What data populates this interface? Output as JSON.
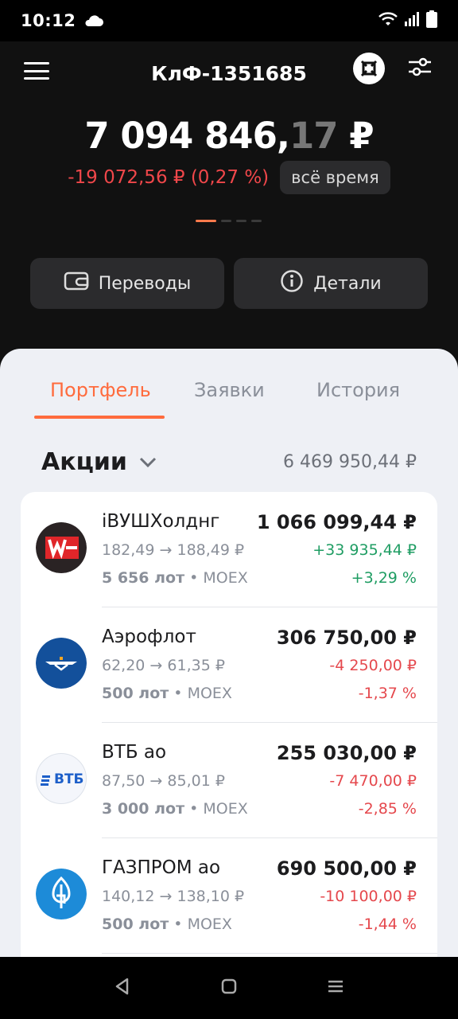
{
  "status_bar": {
    "time": "10:12",
    "icons": [
      "cloud-icon",
      "wifi-icon",
      "signal-icon",
      "battery-icon"
    ]
  },
  "header": {
    "account": "КлФ-1351685",
    "balance": {
      "int": "7 094 846,",
      "frac": "17",
      "currency": " ₽"
    },
    "change": "-19 072,56 ₽ (0,27 %)",
    "period": "всё время",
    "pager": {
      "count": 4,
      "active": 0
    },
    "buttons": {
      "transfers": "Переводы",
      "details": "Детали"
    }
  },
  "tabs": [
    {
      "label": "Портфель",
      "active": true
    },
    {
      "label": "Заявки",
      "active": false
    },
    {
      "label": "История",
      "active": false
    }
  ],
  "section": {
    "title": "Акции",
    "total": "6 469 950,44 ₽"
  },
  "holdings": [
    {
      "name": "iВУШХолднг",
      "prices": "182,49 → 188,49 ₽",
      "lots": "5 656 лот",
      "exchange": "MOEX",
      "value": "1 066 099,44 ₽",
      "change": "+33 935,44 ₽",
      "pct": "+3,29 %",
      "trend": "pos",
      "icon": "whoosh-logo-icon"
    },
    {
      "name": "Аэрофлот",
      "prices": "62,20 → 61,35 ₽",
      "lots": "500 лот",
      "exchange": "MOEX",
      "value": "306 750,00 ₽",
      "change": "-4 250,00 ₽",
      "pct": "-1,37 %",
      "trend": "neg",
      "icon": "aeroflot-logo-icon"
    },
    {
      "name": "ВТБ ао",
      "prices": "87,50 → 85,01 ₽",
      "lots": "3 000 лот",
      "exchange": "MOEX",
      "value": "255 030,00 ₽",
      "change": "-7 470,00 ₽",
      "pct": "-2,85 %",
      "trend": "neg",
      "icon": "vtb-logo-icon",
      "logo_text": "ВТБ"
    },
    {
      "name": "ГАЗПРОМ ао",
      "prices": "140,12 → 138,10 ₽",
      "lots": "500 лот",
      "exchange": "MOEX",
      "value": "690 500,00 ₽",
      "change": "-10 100,00 ₽",
      "pct": "-1,44 %",
      "trend": "neg",
      "icon": "gazprom-logo-icon"
    }
  ],
  "colors": {
    "accent": "#ff6b3d",
    "positive": "#1f9d63",
    "negative": "#e5484d",
    "header_negative": "#f0474a"
  },
  "nav": [
    "back-icon",
    "home-icon",
    "recents-icon"
  ]
}
